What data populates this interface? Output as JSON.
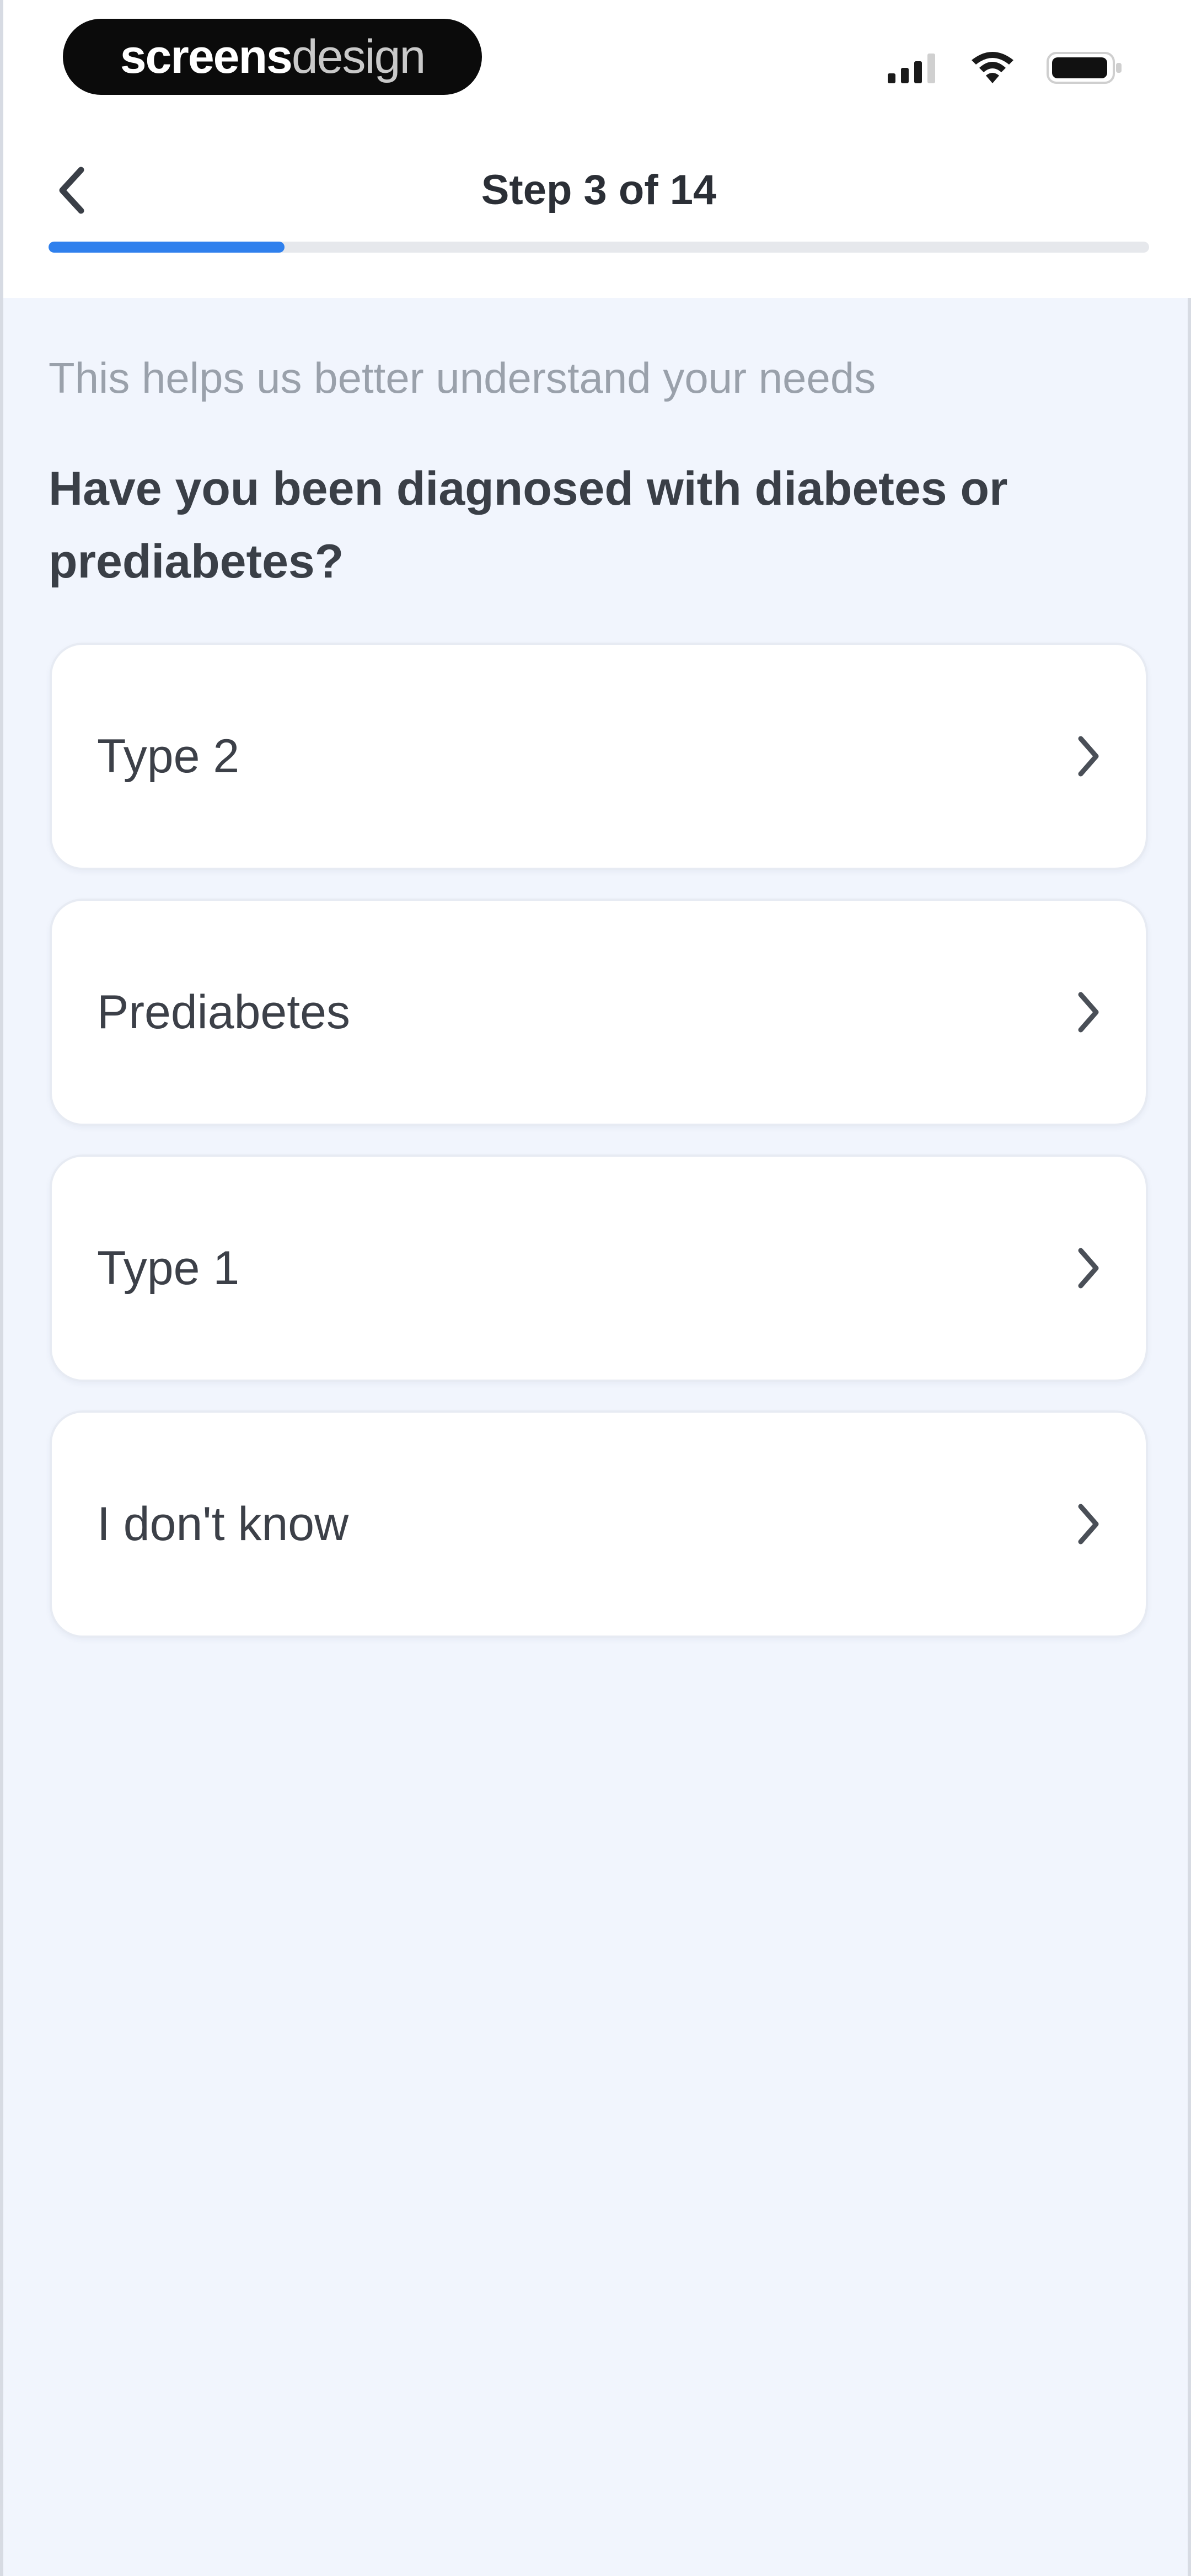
{
  "status_bar": {
    "brand_strong": "screens",
    "brand_light": "design",
    "signal_icon": "cellular-signal-icon",
    "wifi_icon": "wifi-icon",
    "battery_icon": "battery-icon"
  },
  "header": {
    "back_icon": "chevron-left-icon",
    "title": "Step 3 of 14",
    "progress": {
      "current": 3,
      "total": 14
    },
    "accent_color": "#2f80ed"
  },
  "content": {
    "subtitle": "This helps us better understand your needs",
    "question": "Have you been diagnosed with diabetes or prediabetes?",
    "options": [
      {
        "label": "Type 2",
        "icon": "chevron-right-icon"
      },
      {
        "label": "Prediabetes",
        "icon": "chevron-right-icon"
      },
      {
        "label": "Type 1",
        "icon": "chevron-right-icon"
      },
      {
        "label": "I don't know",
        "icon": "chevron-right-icon"
      }
    ]
  },
  "colors": {
    "background": "#f1f5fd",
    "card": "#ffffff",
    "progress_track": "#e6e8ec"
  }
}
